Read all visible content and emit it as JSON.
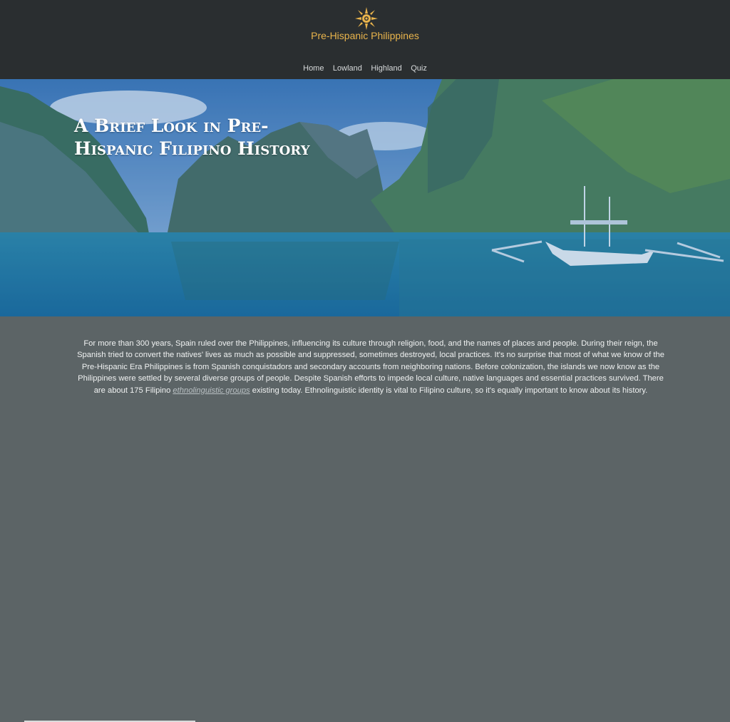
{
  "header": {
    "title": "Pre-Hispanic Philippines",
    "logo_icon": "sun-icon",
    "accent_color": "#e9b44c"
  },
  "nav": {
    "items": [
      {
        "label": "Home"
      },
      {
        "label": "Lowland"
      },
      {
        "label": "Highland"
      },
      {
        "label": "Quiz"
      }
    ]
  },
  "hero": {
    "title_line1": "A Brief Look in Pre-",
    "title_line2": "Hispanic Filipino History"
  },
  "intro": {
    "text_before_link": "For more than 300 years, Spain ruled over the Philippines, influencing its culture through religion, food, and the names of places and people. During their reign, the Spanish tried to convert the natives' lives as much as possible and suppressed, sometimes destroyed, local practices. It's no surprise that most of what we know of the Pre-Hispanic Era Philippines is from Spanish conquistadors and secondary accounts from neighboring nations. Before colonization, the islands we now know as the Philippines were settled by several diverse groups of people. Despite Spanish efforts to impede local culture, native languages and essential practices survived. There are about 175 Filipino ",
    "link_text": "ethnolinguistic groups",
    "text_after_link": " existing today. Ethnolinguistic identity is vital to Filipino culture, so it's equally important to know about its history."
  }
}
